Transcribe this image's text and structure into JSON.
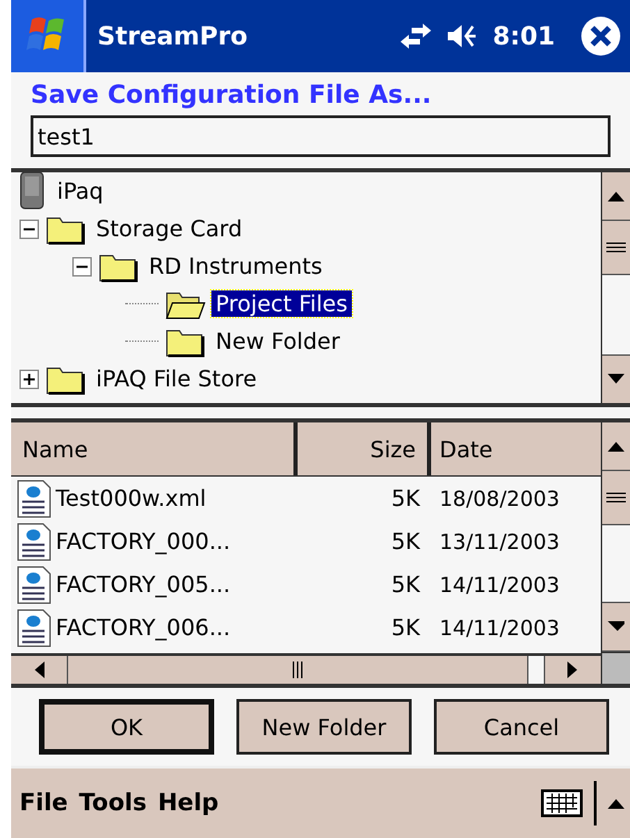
{
  "title_bar": {
    "title": "StreamPro",
    "time": "8:01"
  },
  "dialog_title": "Save Configuration File As...",
  "filename_field": {
    "value": "test1"
  },
  "tree": [
    {
      "label": "iPaq",
      "kind": "device",
      "children": [
        {
          "label": "Storage Card",
          "kind": "folder",
          "expanded": true,
          "selected": false,
          "children": [
            {
              "label": "RD Instruments",
              "kind": "folder",
              "expanded": true,
              "selected": false,
              "children": [
                {
                  "label": "Project Files",
                  "kind": "open-folder",
                  "selected": true
                },
                {
                  "label": "New Folder",
                  "kind": "folder",
                  "selected": false
                }
              ]
            }
          ]
        },
        {
          "label": "iPAQ File Store",
          "kind": "folder",
          "expanded": false,
          "selected": false
        }
      ]
    }
  ],
  "file_list": {
    "columns": [
      "Name",
      "Size",
      "Date"
    ],
    "rows": [
      {
        "name": "Test000w.xml",
        "size": "5K",
        "date": "18/08/2003"
      },
      {
        "name": "FACTORY_000...",
        "size": "5K",
        "date": "13/11/2003"
      },
      {
        "name": "FACTORY_005...",
        "size": "5K",
        "date": "14/11/2003"
      },
      {
        "name": "FACTORY_006...",
        "size": "5K",
        "date": "14/11/2003"
      }
    ]
  },
  "buttons": [
    {
      "label": "OK",
      "default": true
    },
    {
      "label": "New Folder",
      "default": false
    },
    {
      "label": "Cancel",
      "default": false
    }
  ],
  "menu": [
    "File",
    "Tools",
    "Help"
  ]
}
